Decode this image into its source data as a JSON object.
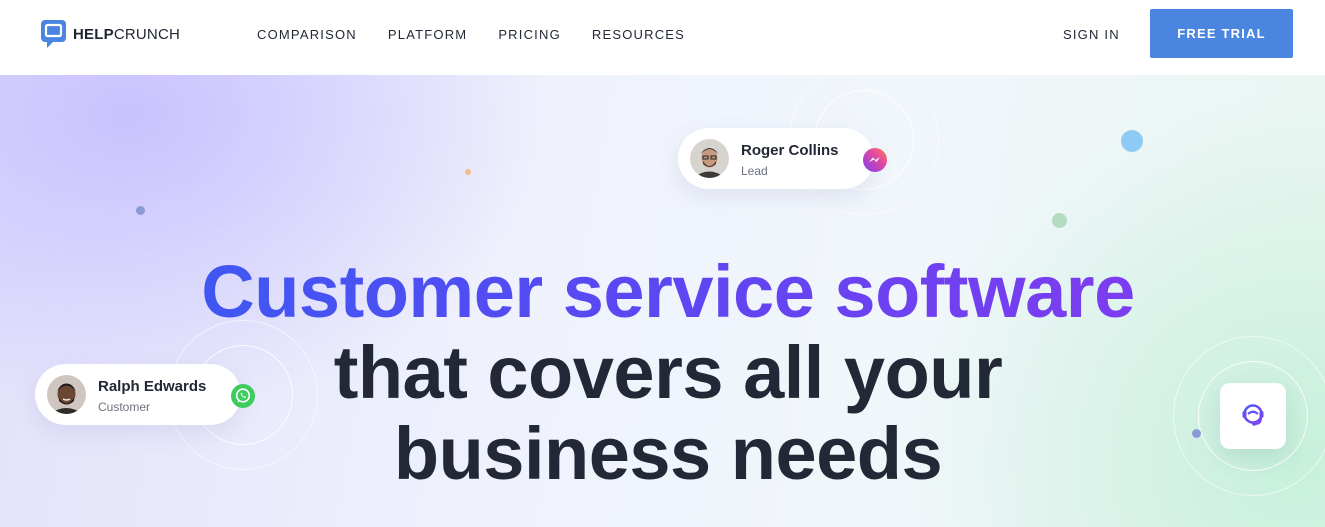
{
  "brand": {
    "logo_bold": "HELP",
    "logo_light": "CRUNCH",
    "color": "#4a86e0"
  },
  "nav": {
    "items": [
      {
        "label": "COMPARISON"
      },
      {
        "label": "PLATFORM"
      },
      {
        "label": "PRICING"
      },
      {
        "label": "RESOURCES"
      }
    ],
    "sign_in": "SIGN IN",
    "free_trial": "FREE TRIAL"
  },
  "hero": {
    "headline_line1": "Customer service software",
    "headline_line2": "that covers all your",
    "headline_line3": "business needs"
  },
  "contacts": [
    {
      "name": "Roger Collins",
      "role": "Lead",
      "channel_icon": "messenger-icon"
    },
    {
      "name": "Ralph Edwards",
      "role": "Customer",
      "channel_icon": "whatsapp-icon"
    }
  ],
  "support_icon": "headset-agent-icon"
}
